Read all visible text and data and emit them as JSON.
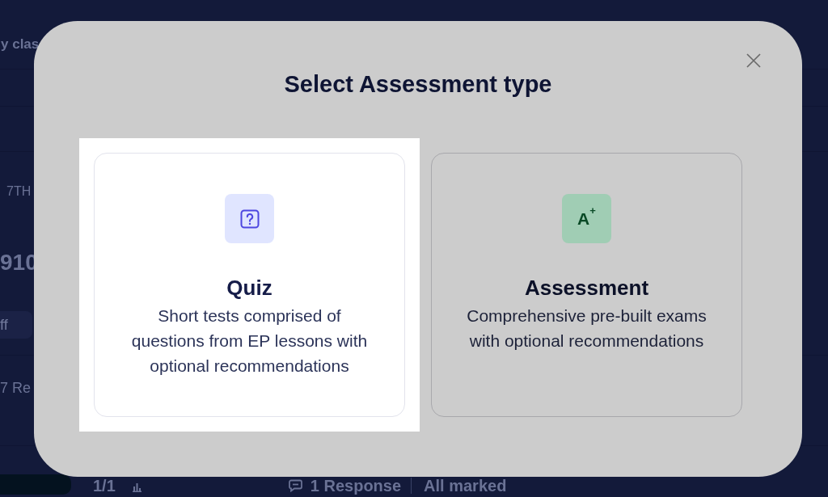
{
  "background_page": {
    "heading": "y clas",
    "grade_label": "7TH",
    "score": "910",
    "toggle_label": "ff",
    "responses_label": "7 Re",
    "footer": {
      "count": "1/1",
      "responses": "1 Response",
      "status": "All marked"
    }
  },
  "dialog": {
    "title": "Select Assessment type",
    "options": [
      {
        "kind": "quiz",
        "title": "Quiz",
        "description": "Short tests comprised of\nquestions from EP lessons with\noptional recommendations",
        "spotlight": true
      },
      {
        "kind": "assessment",
        "title": "Assessment",
        "icon_text": "A$^{+}$",
        "description": "Comprehensive pre-built exams\nwith optional recommendations",
        "spotlight": false
      }
    ]
  }
}
